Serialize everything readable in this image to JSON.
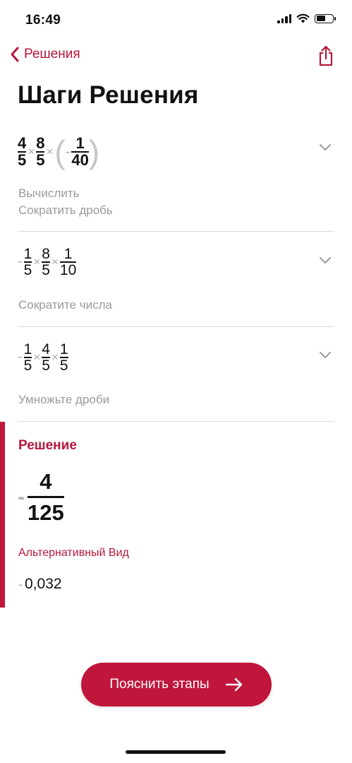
{
  "status_bar": {
    "time": "16:49",
    "battery_level": 0.55
  },
  "nav": {
    "back_label": "Решения",
    "back_icon": "chevron-left-icon",
    "share_icon": "share-icon"
  },
  "title": "Шаги Решения",
  "steps": [
    {
      "expression": {
        "f1": {
          "num": "4",
          "den": "5"
        },
        "op1": "×",
        "f2": {
          "num": "8",
          "den": "5"
        },
        "op2": "×",
        "paren_open": "(",
        "minus": "-",
        "f3": {
          "num": "1",
          "den": "40"
        },
        "paren_close": ")"
      },
      "descriptions": [
        "Вычислить",
        "Сократить дробь"
      ]
    },
    {
      "expression": {
        "minus": "-",
        "f1": {
          "num": "1",
          "den": "5"
        },
        "op1": "×",
        "f2": {
          "num": "8",
          "den": "5"
        },
        "op2": "×",
        "f3": {
          "num": "1",
          "den": "10"
        }
      },
      "descriptions": [
        "Сократите числа"
      ]
    },
    {
      "expression": {
        "minus": "-",
        "f1": {
          "num": "1",
          "den": "5"
        },
        "op1": "×",
        "f2": {
          "num": "4",
          "den": "5"
        },
        "op2": "×",
        "f3": {
          "num": "1",
          "den": "5"
        }
      },
      "descriptions": [
        "Умножьте дроби"
      ]
    }
  ],
  "answer": {
    "title": "Решение",
    "minus": "-",
    "numerator": "4",
    "denominator": "125",
    "alt_title": "Альтернативный Вид",
    "alt_minus": "-",
    "alt_value": "0,032"
  },
  "explain_button": {
    "label": "Пояснить этапы",
    "icon": "arrow-right-icon"
  },
  "colors": {
    "accent": "#c0163b",
    "muted": "#9a9a9a",
    "divider": "#dcdcdc"
  }
}
